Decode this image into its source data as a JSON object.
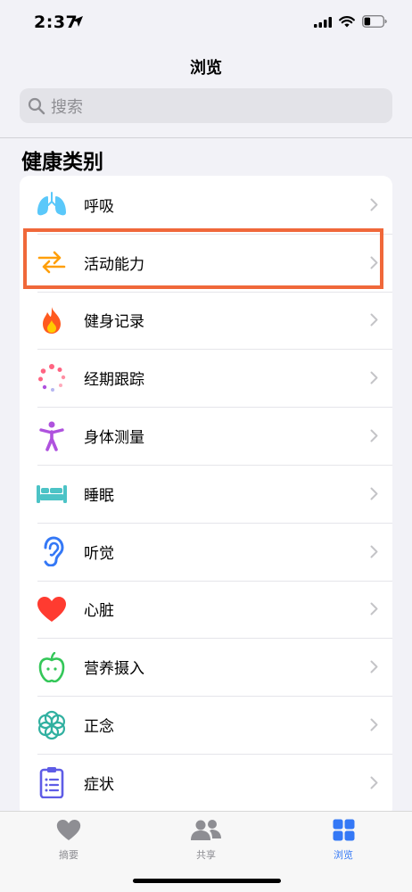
{
  "status_bar": {
    "time": "2:37"
  },
  "nav": {
    "title": "浏览"
  },
  "search": {
    "placeholder": "搜索"
  },
  "section": {
    "title": "健康类别"
  },
  "categories": [
    {
      "label": "呼吸",
      "icon": "lungs-icon",
      "color": "#5ac8fa"
    },
    {
      "label": "活动能力",
      "icon": "mobility-arrows-icon",
      "color": "#ff9f0a"
    },
    {
      "label": "健身记录",
      "icon": "flame-icon",
      "color": "#ff5a1f"
    },
    {
      "label": "经期跟踪",
      "icon": "cycle-dots-icon",
      "color": "#ff6482"
    },
    {
      "label": "身体测量",
      "icon": "body-figure-icon",
      "color": "#af52de"
    },
    {
      "label": "睡眠",
      "icon": "bed-icon",
      "color": "#4cc3c6"
    },
    {
      "label": "听觉",
      "icon": "ear-icon",
      "color": "#3478f6"
    },
    {
      "label": "心脏",
      "icon": "heart-icon",
      "color": "#ff3b30"
    },
    {
      "label": "营养摄入",
      "icon": "apple-icon",
      "color": "#34c759"
    },
    {
      "label": "正念",
      "icon": "mindfulness-flower-icon",
      "color": "#30b0a0"
    },
    {
      "label": "症状",
      "icon": "clipboard-icon",
      "color": "#5e5ce6"
    }
  ],
  "highlight": {
    "color": "#f0683a",
    "target": "活动能力"
  },
  "tabs": [
    {
      "label": "摘要",
      "icon": "heart-icon",
      "selected": false
    },
    {
      "label": "共享",
      "icon": "people-icon",
      "selected": false
    },
    {
      "label": "浏览",
      "icon": "grid-icon",
      "selected": true
    }
  ],
  "colors": {
    "accent": "#3478f6",
    "inactive": "#8e8e93"
  }
}
